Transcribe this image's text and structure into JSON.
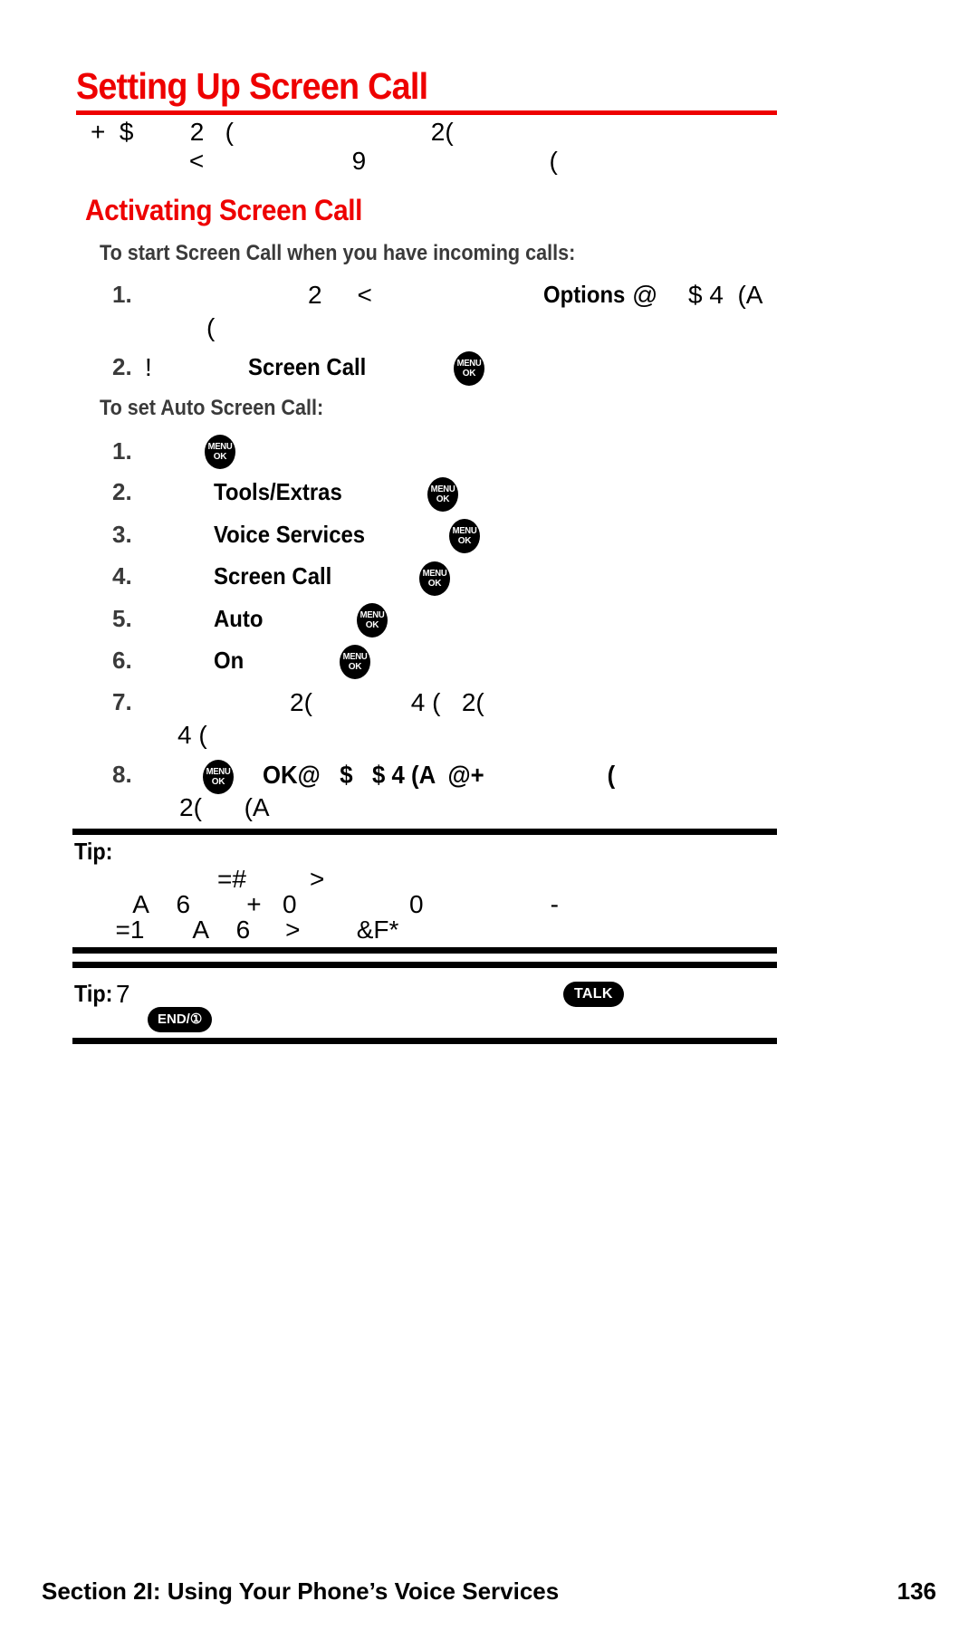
{
  "document": {
    "title": "Setting Up Screen Call",
    "accent_color": "#ee0000",
    "text_color": "#000000",
    "subhead_color": "#3a3a3a"
  },
  "intro": {
    "line1": "+  $        2   (                            2(",
    "line2": "              <                     9                          ("
  },
  "activating": {
    "heading": "Activating Screen Call",
    "subhead_start": "To start Screen Call when you have incoming calls:",
    "subhead_auto": "To set Auto Screen Call:"
  },
  "start_steps": [
    {
      "number": "1.",
      "pre": "2     <",
      "bold1": "Options",
      "at": "@",
      "tail": "$ 4  (A",
      "cont": "("
    },
    {
      "number": "2.",
      "pre": "!",
      "bold1": "Screen Call",
      "key": "menu-ok"
    }
  ],
  "auto_steps": [
    {
      "number": "1.",
      "label": "",
      "key": "menu-ok"
    },
    {
      "number": "2.",
      "label": "Tools/Extras",
      "key": "menu-ok"
    },
    {
      "number": "3.",
      "label": "Voice Services",
      "key": "menu-ok"
    },
    {
      "number": "4.",
      "label": "Screen Call",
      "key": "menu-ok"
    },
    {
      "number": "5.",
      "label": "Auto",
      "key": "menu-ok"
    },
    {
      "number": "6.",
      "label": "On",
      "key": "menu-ok"
    },
    {
      "number": "7.",
      "label": "2(              4 (   2(",
      "cont": "4 (",
      "key": ""
    },
    {
      "number": "8.",
      "label": "OK@   $   $ 4 (A  @+                   (",
      "cont": "2(      (A",
      "key": "menu-ok"
    }
  ],
  "tips": [
    {
      "label": "Tip:",
      "line1": "=#         >",
      "line2": " A    6        +   0                0                  -",
      "line3": "  =1       A    6     >        &F*"
    },
    {
      "label": "Tip:",
      "lead": "7",
      "key1": "TALK",
      "key2": "END/①"
    }
  ],
  "keys": {
    "menu_top": "MENU",
    "menu_bottom": "OK",
    "talk": "TALK",
    "end": "END/①"
  },
  "footer": {
    "section": "Section 2I: Using Your Phone’s Voice Services",
    "page_number": "136"
  }
}
